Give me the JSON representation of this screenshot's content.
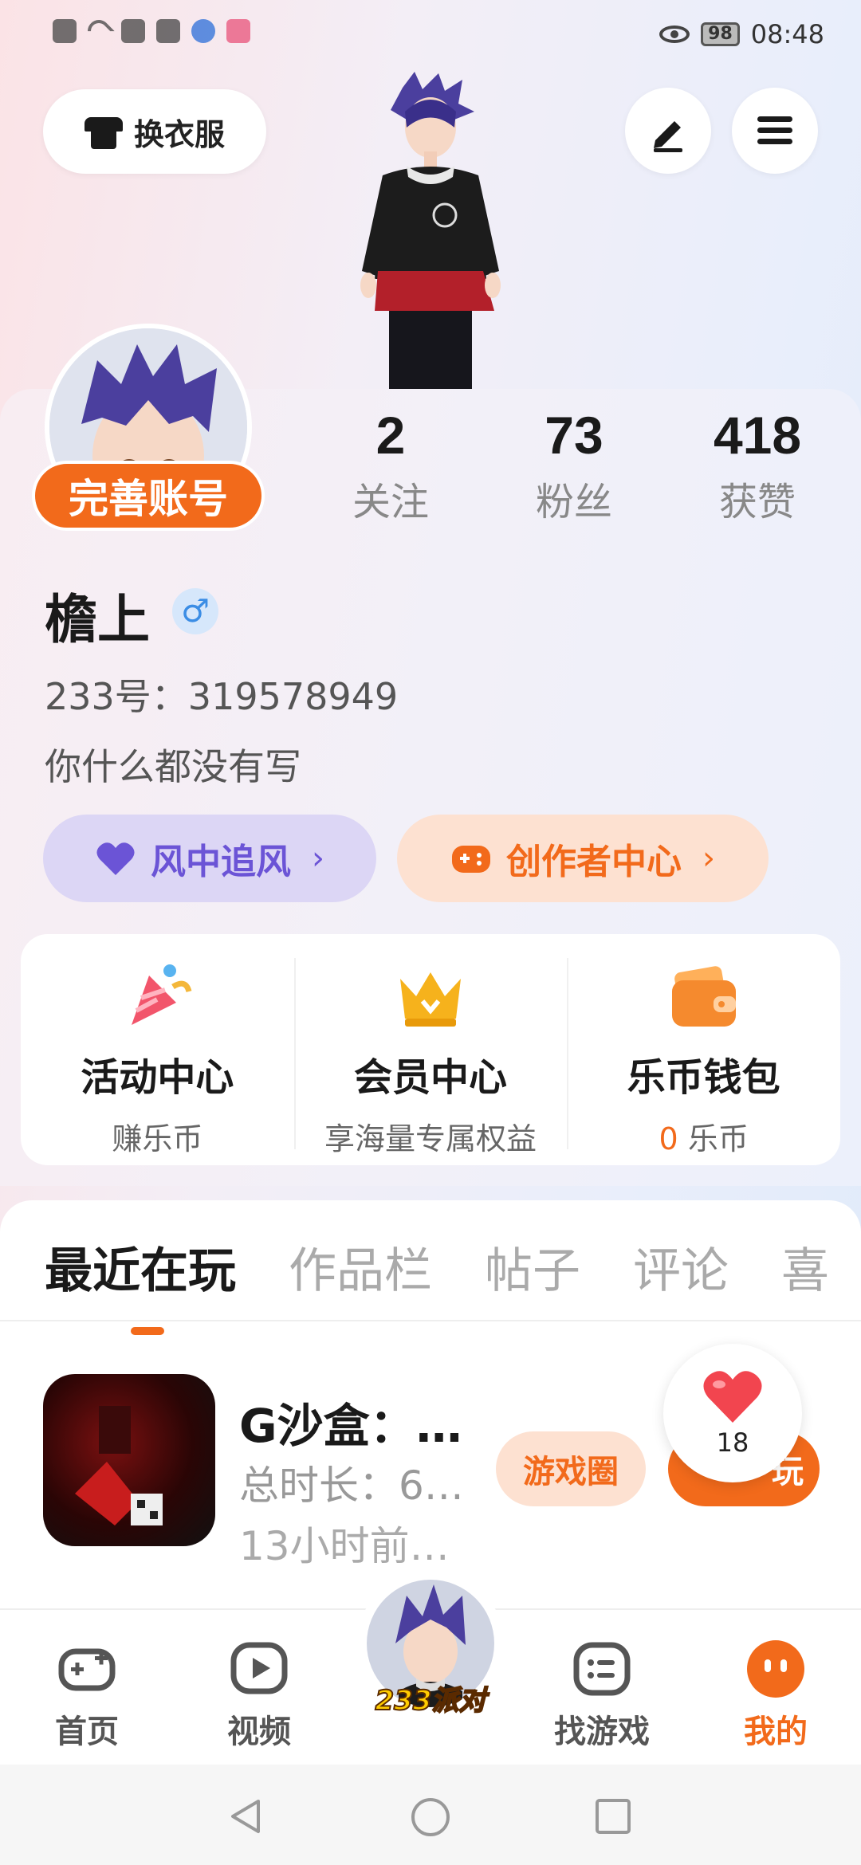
{
  "status_bar": {
    "time": "08:48",
    "battery": "98"
  },
  "top": {
    "outfit_label": "换衣服"
  },
  "profile": {
    "complete_label": "完善账号",
    "stats": [
      {
        "value": "2",
        "label": "关注"
      },
      {
        "value": "73",
        "label": "粉丝"
      },
      {
        "value": "418",
        "label": "获赞"
      }
    ],
    "username": "檐上",
    "gender_symbol": "♂",
    "user_id": "233号：319578949",
    "bio": "你什么都没有写",
    "wind_label": "风中追风",
    "creator_label": "创作者中心",
    "chevron": "›"
  },
  "services": [
    {
      "title": "活动中心",
      "subtitle": "赚乐币",
      "icon": "party-popper-icon"
    },
    {
      "title": "会员中心",
      "subtitle": "享海量专属权益",
      "icon": "crown-icon"
    },
    {
      "title": "乐币钱包",
      "subtitle_num": "0",
      "subtitle": "乐币",
      "icon": "wallet-icon"
    }
  ],
  "tabs": [
    "最近在玩",
    "作品栏",
    "帖子",
    "评论",
    "喜"
  ],
  "recent_game": {
    "name": "G沙盒：…",
    "total_time": "总时长：6…",
    "last_played": "13小时前…",
    "circle_label": "游戏圈",
    "play_label": "玩"
  },
  "like_bubble": {
    "count": "18"
  },
  "bottom_nav": {
    "home": "首页",
    "video": "视频",
    "center": "233派对",
    "find_game": "找游戏",
    "mine": "我的"
  },
  "colors": {
    "accent": "#f26a1b",
    "purple": "#6b54d6"
  }
}
